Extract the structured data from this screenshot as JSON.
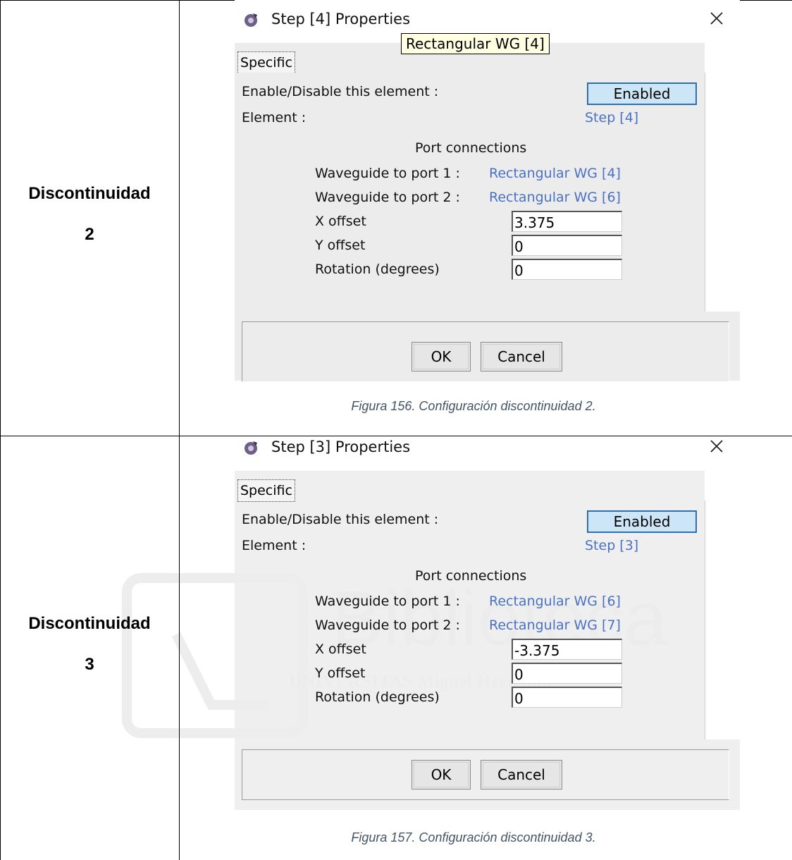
{
  "rows": [
    {
      "label_line1": "Discontinuidad",
      "label_line2": "2",
      "dialog": {
        "title": "Step [4] Properties",
        "tooltip": "Rectangular WG [4]",
        "tab": "Specific",
        "enable_label": "Enable/Disable this element :",
        "enable_value": "Enabled",
        "element_label": "Element :",
        "element_value": "Step [4]",
        "section_title": "Port connections",
        "port1_label": "Waveguide to port 1 :",
        "port1_value": "Rectangular WG [4]",
        "port2_label": "Waveguide to port 2 :",
        "port2_value": "Rectangular WG [6]",
        "xoffset_label": "X offset",
        "xoffset_value": "3.375",
        "yoffset_label": "Y offset",
        "yoffset_value": "0",
        "rotation_label": "Rotation (degrees)",
        "rotation_value": "0",
        "ok_label": "OK",
        "cancel_label": "Cancel"
      },
      "caption": "Figura 156. Configuración discontinuidad 2."
    },
    {
      "label_line1": "Discontinuidad",
      "label_line2": "3",
      "dialog": {
        "title": "Step [3] Properties",
        "tab": "Specific",
        "enable_label": "Enable/Disable this element :",
        "enable_value": "Enabled",
        "element_label": "Element :",
        "element_value": "Step [3]",
        "section_title": "Port connections",
        "port1_label": "Waveguide to port 1 :",
        "port1_value": "Rectangular WG [6]",
        "port2_label": "Waveguide to port 2 :",
        "port2_value": "Rectangular WG [7]",
        "xoffset_label": "X offset",
        "xoffset_value": "-3.375",
        "yoffset_label": "Y offset",
        "yoffset_value": "0",
        "rotation_label": "Rotation (degrees)",
        "rotation_value": "0",
        "ok_label": "OK",
        "cancel_label": "Cancel"
      },
      "caption": "Figura 157. Configuración discontinuidad 3."
    }
  ],
  "watermark_text": "Biblioteca",
  "watermark_subtext": "UNIVERSITAS Miguel Hernández"
}
